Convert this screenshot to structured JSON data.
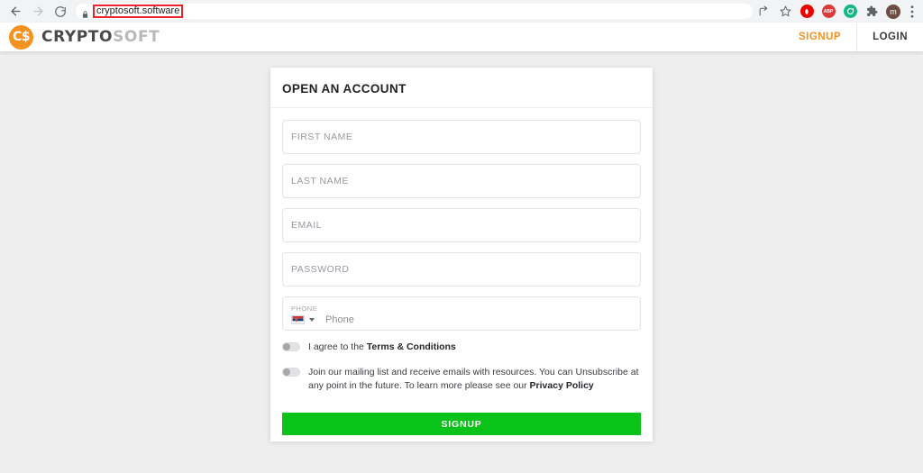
{
  "browser": {
    "back_icon": "arrow-left-icon",
    "forward_icon": "arrow-right-icon",
    "reload_icon": "reload-icon",
    "lock_icon": "lock-icon",
    "url": "cryptosoft.software",
    "url_highlight_color": "#e8262b",
    "toolbar_icons": [
      {
        "name": "share-icon",
        "glyph": "↪",
        "color": "#5f6368"
      },
      {
        "name": "bookmark-star-icon",
        "glyph": "☆",
        "color": "#5f6368"
      },
      {
        "name": "opera-extension-icon",
        "glyph": "",
        "color": "#ee0000"
      },
      {
        "name": "adblock-plus-icon",
        "glyph": "ABP",
        "color": "#d93b3b"
      },
      {
        "name": "green-extension-icon",
        "glyph": "",
        "color": "#12b886"
      },
      {
        "name": "puzzle-extensions-icon",
        "glyph": "✦",
        "color": "#5f6368"
      },
      {
        "name": "profile-avatar",
        "glyph": "m",
        "color": "#6d4c41"
      },
      {
        "name": "kebab-menu-icon",
        "glyph": "⋮",
        "color": "#5f6368"
      }
    ]
  },
  "site_header": {
    "logo_mark": "C$",
    "logo_text_primary": "CRYPTO",
    "logo_text_secondary": "SOFT",
    "logo_accent_color": "#f3921f",
    "nav": [
      {
        "label": "SIGNUP",
        "name": "header-link-signup"
      },
      {
        "label": "LOGIN",
        "name": "header-link-login"
      }
    ]
  },
  "signup_card": {
    "title": "OPEN AN ACCOUNT",
    "fields": [
      {
        "name": "first-name-input",
        "placeholder": "FIRST NAME",
        "value": ""
      },
      {
        "name": "last-name-input",
        "placeholder": "LAST NAME",
        "value": ""
      },
      {
        "name": "email-input",
        "placeholder": "EMAIL",
        "value": ""
      },
      {
        "name": "password-input",
        "placeholder": "PASSWORD",
        "value": ""
      }
    ],
    "phone": {
      "label": "PHONE",
      "placeholder": "Phone",
      "value": "",
      "country_flag": "serbia-flag-icon"
    },
    "toggles": [
      {
        "name": "terms-toggle",
        "state": "off",
        "text_before": "I agree to the ",
        "link_text": "Terms & Conditions",
        "text_after": ""
      },
      {
        "name": "mailing-list-toggle",
        "state": "off",
        "text_before": "Join our mailing list and receive emails with resources. You can Unsubscribe at any point in the future. To learn more please see our ",
        "link_text": "Privacy Policy",
        "text_after": ""
      }
    ],
    "submit": {
      "label": "SIGNUP",
      "color": "#0ac318"
    }
  }
}
